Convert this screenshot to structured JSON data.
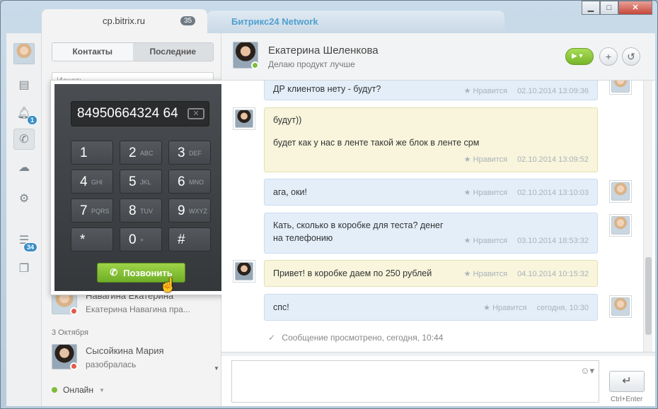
{
  "window": {
    "tabs": [
      {
        "label": "cp.bitrix.ru",
        "badge": "35"
      },
      {
        "label": "Битрикс24 Network"
      }
    ],
    "controls": {
      "minimize": "▁",
      "maximize": "□",
      "close": "✕"
    }
  },
  "rail": {
    "notifications_badge": "1",
    "tasks_badge": "34"
  },
  "contacts": {
    "tab_contacts": "Контакты",
    "tab_recent": "Последние",
    "search_placeholder": "Искать",
    "items": [
      {
        "name": "Навагина Екатерина",
        "message": "Екатерина Навагина пра..."
      },
      {
        "name": "Сысойкина Мария",
        "message": "разобралась"
      }
    ],
    "date_separator": "3 Октября",
    "status": "Онлайн"
  },
  "dialpad": {
    "number": "84950664324 64",
    "keys": [
      {
        "digit": "1",
        "letters": ""
      },
      {
        "digit": "2",
        "letters": "ABC"
      },
      {
        "digit": "3",
        "letters": "DEF"
      },
      {
        "digit": "4",
        "letters": "GHI"
      },
      {
        "digit": "5",
        "letters": "JKL"
      },
      {
        "digit": "6",
        "letters": "MNO"
      },
      {
        "digit": "7",
        "letters": "PQRS"
      },
      {
        "digit": "8",
        "letters": "TUV"
      },
      {
        "digit": "9",
        "letters": "WXYZ"
      },
      {
        "digit": "*",
        "letters": ""
      },
      {
        "digit": "0",
        "letters": "+"
      },
      {
        "digit": "#",
        "letters": ""
      }
    ],
    "call_label": "Позвонить"
  },
  "chat": {
    "name": "Екатерина Шеленкова",
    "status": "Делаю продукт лучше",
    "like_label": "★ Нравится",
    "messages": [
      {
        "text": "ДР клиентов нету - будут?",
        "time": "02.10.2014 13:09:36"
      },
      {
        "text": "будут))",
        "text2": "будет как у нас в ленте такой же блок в ленте срм",
        "time": "02.10.2014 13:09:52"
      },
      {
        "text": "ага, оки!",
        "time": "02.10.2014 13:10:03"
      },
      {
        "text": "Кать, сколько в коробке для теста? денег",
        "text2": "на телефонию",
        "time": "03.10.2014 18:53:32"
      },
      {
        "text": "Привет! в коробке даем по 250 рублей",
        "time": "04.10.2014 10:15:32"
      },
      {
        "text": "спс!",
        "time": "сегодня, 10:30"
      }
    ],
    "seen": "Сообщение просмотрено, сегодня, 10:44",
    "send_hint": "Ctrl+Enter"
  }
}
